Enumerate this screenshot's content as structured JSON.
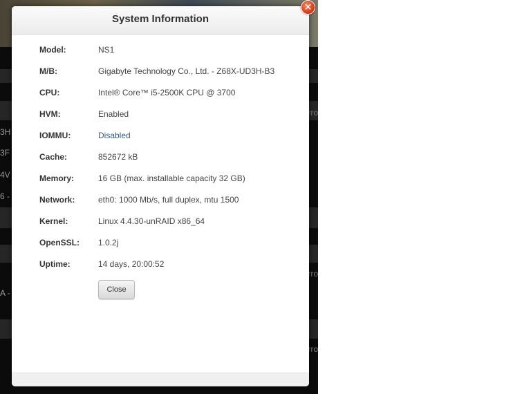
{
  "backdrop": {
    "row_fragments": [
      "3H -",
      "3F -",
      "4V",
      "6 -",
      "A -"
    ],
    "right_fragments": [
      "rro",
      "rro",
      "rro"
    ]
  },
  "dialog": {
    "title": "System Information",
    "close_icon": "close-icon",
    "rows": [
      {
        "label": "Model:",
        "value": "NS1"
      },
      {
        "label": "M/B:",
        "value": "Gigabyte Technology Co., Ltd. - Z68X-UD3H-B3"
      },
      {
        "label": "CPU:",
        "value": "Intel® Core™ i5-2500K CPU @ 3700"
      },
      {
        "label": "HVM:",
        "value": "Enabled"
      },
      {
        "label": "IOMMU:",
        "value": "Disabled"
      },
      {
        "label": "Cache:",
        "value": "852672 kB"
      },
      {
        "label": "Memory:",
        "value": "16 GB (max. installable capacity 32 GB)"
      },
      {
        "label": "Network:",
        "value": "eth0: 1000 Mb/s, full duplex, mtu 1500"
      },
      {
        "label": "Kernel:",
        "value": "Linux 4.4.30-unRAID x86_64"
      },
      {
        "label": "OpenSSL:",
        "value": "1.0.2j"
      },
      {
        "label": "Uptime:",
        "value": "14 days, 20:00:52"
      }
    ],
    "close_button": "Close"
  },
  "colors": {
    "link": "#2f5b85",
    "close_badge": "#d9300d"
  }
}
